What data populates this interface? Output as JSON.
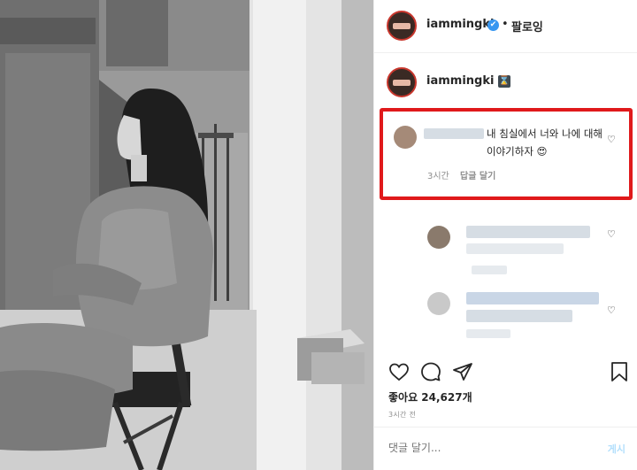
{
  "header": {
    "username": "iammingki",
    "verified_glyph": "✔",
    "separator": "•",
    "follow_label": "팔로잉"
  },
  "caption": {
    "username": "iammingki"
  },
  "highlighted_comment": {
    "text": "내 침실에서 너와 나에 대해 이야기하자 😍",
    "time": "3시간",
    "reply_label": "답글 달기"
  },
  "post_actions": {
    "likes": "좋아요 24,627개",
    "time": "3시간 전"
  },
  "comment_form": {
    "placeholder": "댓글 달기...",
    "post_label": "게시"
  },
  "icons": [
    "heart-icon",
    "comment-icon",
    "share-icon",
    "bookmark-icon",
    "verified-icon",
    "hourglass-icon"
  ],
  "colors": {
    "highlight": "#e0191b",
    "verified": "#3897f0",
    "post_button": "#b2dffc"
  }
}
